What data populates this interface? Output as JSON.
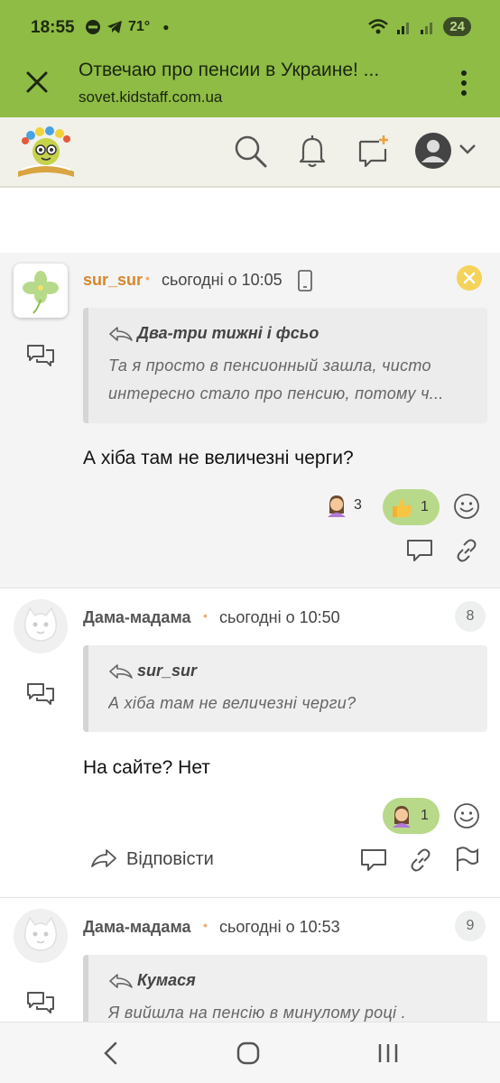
{
  "status": {
    "time": "18:55",
    "temperature": "71°",
    "battery": "24",
    "icons": [
      "do-not-disturb-icon",
      "telegram-icon",
      "wifi-icon",
      "signal-icon"
    ]
  },
  "tab": {
    "title": "Отвечаю про пенсии в Украине! ...",
    "url": "sovet.kidstaff.com.ua"
  },
  "header": {
    "icons": [
      "search-icon",
      "bell-icon",
      "new-message-icon",
      "account-icon"
    ]
  },
  "posts": [
    {
      "author": "sur_sur",
      "time": "сьогодні о 10:05",
      "quote_author": "Два-три тижні і фсьо",
      "quote_line1": "Та я просто в пенсионный зашла, чисто",
      "quote_line2": "интересно стало про пенсию, потому ч...",
      "text": "А хіба там не величезні черги?",
      "reaction1_count": "3",
      "reaction2_count": "1"
    },
    {
      "author": "Дама-мадама",
      "time": "сьогодні о 10:50",
      "number": "8",
      "quote_author": "sur_sur",
      "quote_line1": "А хіба там не величезні черги?",
      "text": "На сайте? Нет",
      "reaction_count": "1",
      "reply_label": "Відповісти"
    },
    {
      "author": "Дама-мадама",
      "time": "сьогодні о 10:53",
      "number": "9",
      "quote_author": "Кумася",
      "quote_line1": "Я вийшла на пенсію в минулому році ."
    }
  ],
  "colors": {
    "accent": "#8fbc45",
    "reaction_pill": "#b8d98a",
    "author_highlight": "#d9862c"
  }
}
